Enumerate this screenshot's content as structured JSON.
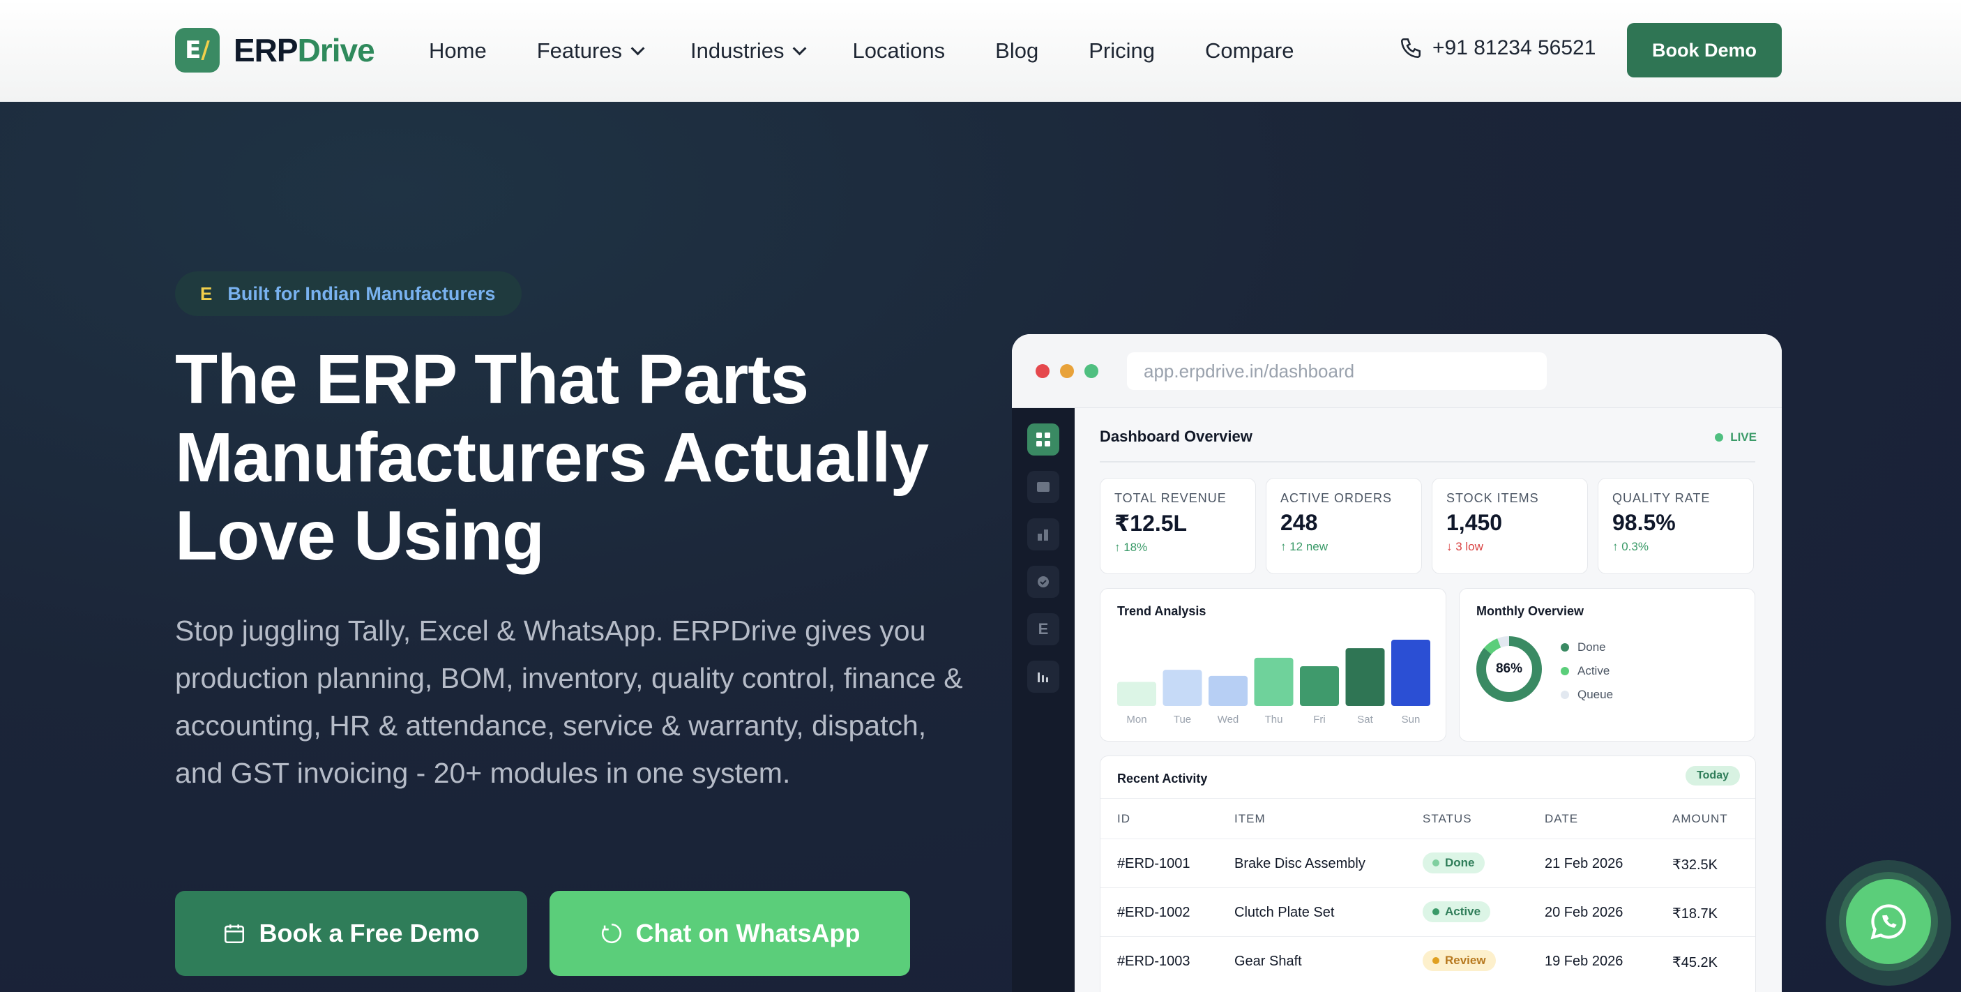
{
  "nav": {
    "logo_mark": "E",
    "logo_part1": "ERP",
    "logo_part2": "Drive",
    "items": [
      {
        "label": "Home"
      },
      {
        "label": "Features"
      },
      {
        "label": "Industries"
      },
      {
        "label": "Locations"
      },
      {
        "label": "Blog"
      },
      {
        "label": "Pricing"
      },
      {
        "label": "Compare"
      }
    ],
    "phone": "+91 81234 56521",
    "cta": "Book Demo"
  },
  "hero": {
    "badge_icon": "E",
    "badge": "Built for Indian Manufacturers",
    "title_line1": "The ERP That Parts",
    "title_line2": "Manufacturers Actually",
    "title_line3": "Love Using",
    "subtitle": "Stop juggling Tally, Excel & WhatsApp. ERPDrive gives you production planning, BOM, inventory, quality control, finance & accounting, HR & attendance, service & warranty, dispatch, and GST invoicing - 20+ modules in one system.",
    "btn_demo": "Book a Free Demo",
    "btn_whatsapp": "Chat on WhatsApp"
  },
  "mockup": {
    "url": "app.erpdrive.in/dashboard",
    "sidebar_letter": "E",
    "title": "Dashboard Overview",
    "live": "LIVE",
    "cards": [
      {
        "label": "TOTAL REVENUE",
        "value": "₹12.5L",
        "delta": "↑ 18%"
      },
      {
        "label": "ACTIVE ORDERS",
        "value": "248",
        "delta": "↑ 12 new"
      },
      {
        "label": "STOCK ITEMS",
        "value": "1,450",
        "delta": "↓ 3 low"
      },
      {
        "label": "QUALITY RATE",
        "value": "98.5%",
        "delta": "↑ 0.3%"
      }
    ],
    "trend_title": "Trend Analysis",
    "monthly_title": "Monthly Overview",
    "donut_label": "86%",
    "legend": [
      "Done",
      "Active",
      "Queue"
    ],
    "recent_title": "Recent Activity",
    "today": "Today",
    "columns": [
      "ID",
      "ITEM",
      "STATUS",
      "DATE",
      "AMOUNT"
    ],
    "rows": [
      {
        "id": "#ERD-1001",
        "item": "Brake Disc Assembly",
        "status": "Done",
        "date": "21 Feb 2026",
        "amount": "₹32.5K"
      },
      {
        "id": "#ERD-1002",
        "item": "Clutch Plate Set",
        "status": "Active",
        "date": "20 Feb 2026",
        "amount": "₹18.7K"
      },
      {
        "id": "#ERD-1003",
        "item": "Gear Shaft",
        "status": "Review",
        "date": "19 Feb 2026",
        "amount": "₹45.2K"
      }
    ]
  },
  "chart_data": [
    {
      "type": "bar",
      "title": "Trend Analysis",
      "categories": [
        "Mon",
        "Tue",
        "Wed",
        "Thu",
        "Fri",
        "Sat",
        "Sun"
      ],
      "values": [
        20,
        30,
        25,
        40,
        33,
        48,
        55
      ],
      "ylim": [
        0,
        55
      ],
      "colors": [
        "#dcf5e6",
        "#c6daf7",
        "#b7cff4",
        "#6fd29b",
        "#3f9a6c",
        "#2f7554",
        "#2b4fd4"
      ]
    },
    {
      "type": "pie",
      "title": "Monthly Overview",
      "categories": [
        "Done",
        "Active",
        "Queue"
      ],
      "values": [
        86,
        8,
        6
      ],
      "colors": [
        "#3a8a63",
        "#5bce7a",
        "#e2e8f0"
      ]
    }
  ],
  "colors": {
    "brand": "#2f7554",
    "accent": "#5bce7a",
    "hero_bg": "#1a2236"
  }
}
